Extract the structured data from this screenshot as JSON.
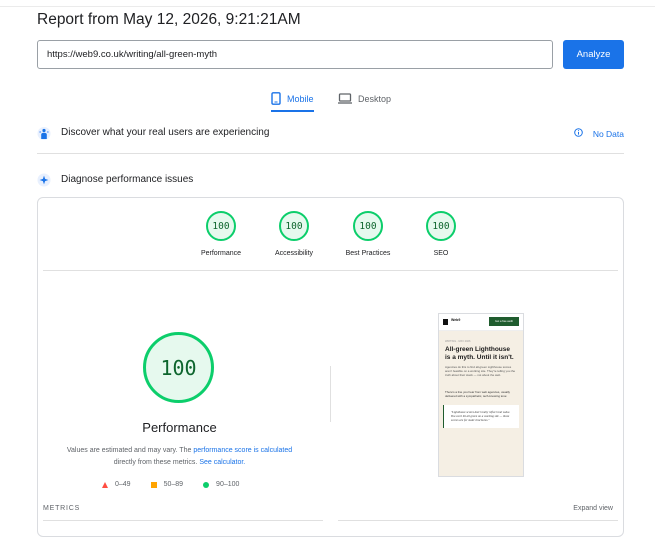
{
  "report": {
    "title": "Report from May 12, 2026, 9:21:21AM"
  },
  "search": {
    "url": "https://web9.co.uk/writing/all-green-myth",
    "analyze_label": "Analyze"
  },
  "tabs": {
    "mobile": "Mobile",
    "desktop": "Desktop"
  },
  "sections": {
    "real_users": "Discover what your real users are experiencing",
    "no_data": "No Data",
    "diagnose": "Diagnose performance issues"
  },
  "scores": [
    {
      "label": "Performance",
      "value": "100"
    },
    {
      "label": "Accessibility",
      "value": "100"
    },
    {
      "label": "Best Practices",
      "value": "100"
    },
    {
      "label": "SEO",
      "value": "100"
    }
  ],
  "performance": {
    "score": "100",
    "title": "Performance",
    "note_prefix": "Values are estimated and may vary. The ",
    "note_link": "performance score is calculated",
    "note_middle": " directly from these metrics. ",
    "note_calc": "See calculator."
  },
  "legend": {
    "poor": "0–49",
    "average": "50–89",
    "good": "90–100"
  },
  "screenshot": {
    "brand": "Web9",
    "cta": "Get a free audit",
    "meta": "WRITING · MAY 2026",
    "headline": "All-green Lighthouse is a myth. Until it isn't.",
    "body": "Agencies do this to find all-green Lighthouse scores aren't feasible on a working site. They're telling you the truth about their stack — not about the web.",
    "body2": "There's a line you hear from web agencies, usually delivered with a sympathetic, tech-knowing tone:",
    "quote": "\"Lighthouse scores don't really reflect real value. You can't hit all green on a working site — those scores are for static brochures.\""
  },
  "metrics": {
    "label": "METRICS",
    "expand": "Expand view"
  },
  "colors": {
    "accent": "#1a73e8",
    "good": "#0cce6b",
    "average": "#ffa400",
    "poor": "#ff4e42"
  }
}
